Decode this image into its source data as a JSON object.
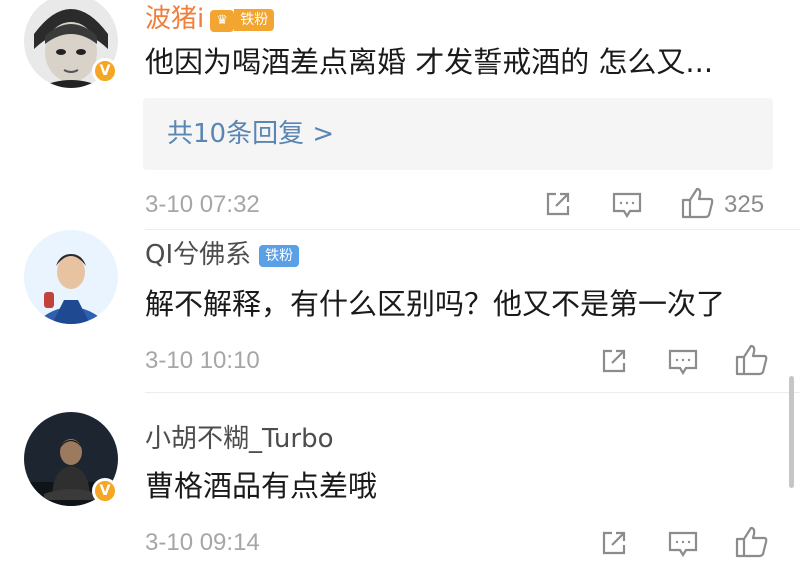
{
  "comments": [
    {
      "username": "波猪i",
      "fan_badge": "铁粉",
      "text": "他因为喝酒差点离婚 才发誓戒酒的 怎么又...",
      "reply_link": "共10条回复 >",
      "time": "3-10 07:32",
      "likes": "325",
      "verified": true
    },
    {
      "username": "QI兮佛系",
      "fan_badge": "铁粉",
      "text": "解不解释，有什么区别吗？他又不是第一次了",
      "time": "3-10 10:10",
      "likes": "",
      "verified": false
    },
    {
      "username": "小胡不糊_Turbo",
      "text": "曹格酒品有点差哦",
      "time": "3-10 09:14",
      "likes": "",
      "verified": true
    }
  ],
  "icons": {
    "share": "share-icon",
    "comment": "comment-icon",
    "like": "thumbs-up-icon",
    "verified": "verified-badge-icon"
  },
  "colors": {
    "vip_name": "#f07f3c",
    "fan_badge": "#5aa0e6",
    "reply_link": "#5a86b4",
    "verified_badge": "#f5a623"
  }
}
